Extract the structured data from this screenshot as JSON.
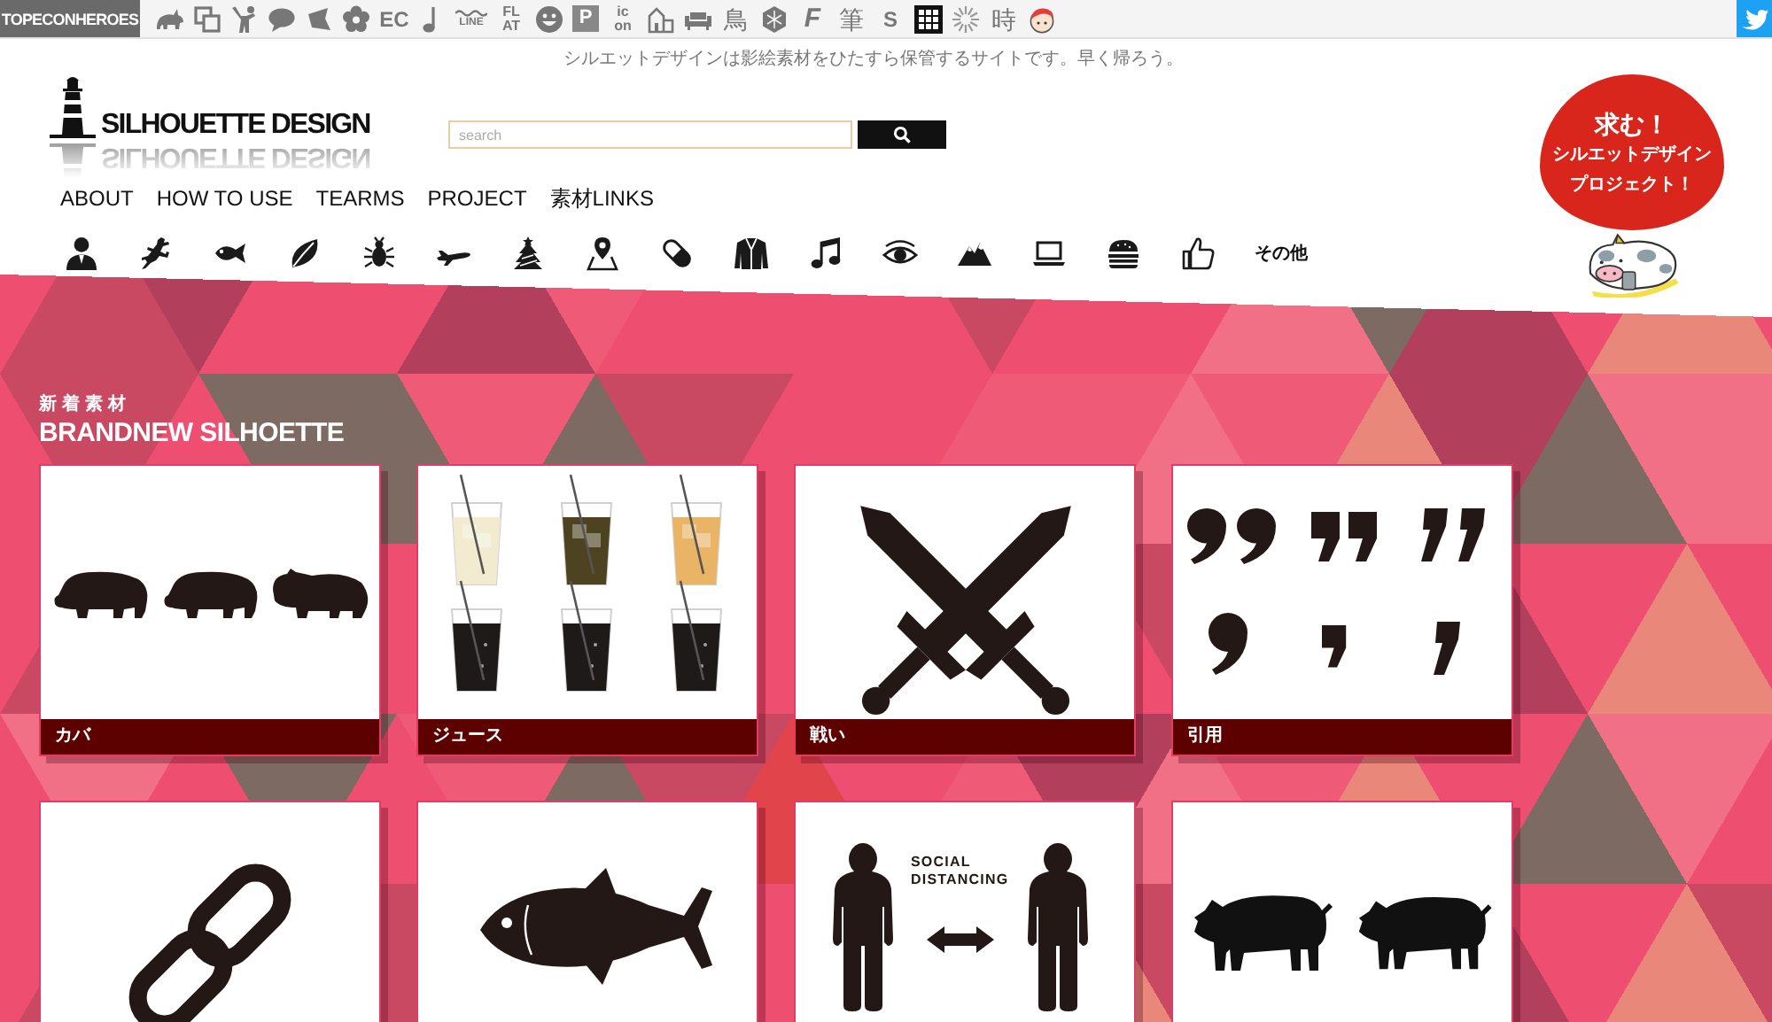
{
  "top_bar": {
    "label": "TOPECONHEROES",
    "site_links": [
      {
        "kind": "icon"
      },
      {
        "kind": "icon"
      },
      {
        "kind": "icon"
      },
      {
        "kind": "icon"
      },
      {
        "kind": "icon"
      },
      {
        "kind": "icon"
      },
      {
        "kind": "text",
        "text": "EC"
      },
      {
        "kind": "icon"
      },
      {
        "kind": "wavy",
        "text": "LINE"
      },
      {
        "kind": "stack",
        "lines": [
          "FL",
          "AT"
        ]
      },
      {
        "kind": "icon"
      },
      {
        "kind": "boxed",
        "text": "P"
      },
      {
        "kind": "stack",
        "lines": [
          "ic",
          "on"
        ]
      },
      {
        "kind": "icon"
      },
      {
        "kind": "icon"
      },
      {
        "kind": "text",
        "text": "鳥"
      },
      {
        "kind": "icon"
      },
      {
        "kind": "slanted",
        "text": "F"
      },
      {
        "kind": "text",
        "text": "筆"
      },
      {
        "kind": "text",
        "text": "S"
      },
      {
        "kind": "icon"
      },
      {
        "kind": "icon"
      },
      {
        "kind": "text",
        "text": "時"
      },
      {
        "kind": "icon"
      }
    ]
  },
  "header": {
    "tagline": "シルエットデザインは影絵素材をひたすら保管するサイトです。早く帰ろう。",
    "logo": "SILHOUETTE DESIGN",
    "search": {
      "placeholder": "search"
    },
    "nav": [
      "ABOUT",
      "HOW TO USE",
      "TEARMS",
      "PROJECT",
      "素材LINKS"
    ],
    "categories_more": "その他"
  },
  "badge": {
    "lines": [
      "求む！",
      "シルエットデザイン",
      "プロジェクト！"
    ]
  },
  "section": {
    "subtitle": "新着素材",
    "title": "BRANDNEW SILHOETTE"
  },
  "cards": [
    {
      "kind": "hippo",
      "caption": "カバ"
    },
    {
      "kind": "juice",
      "caption": "ジュース"
    },
    {
      "kind": "swords",
      "caption": "戦い"
    },
    {
      "kind": "quotes",
      "caption": "引用"
    },
    {
      "kind": "chain"
    },
    {
      "kind": "tuna"
    },
    {
      "kind": "distancing",
      "image_text": [
        "SOCIAL",
        "DISTANCING"
      ]
    },
    {
      "kind": "pigs"
    }
  ]
}
